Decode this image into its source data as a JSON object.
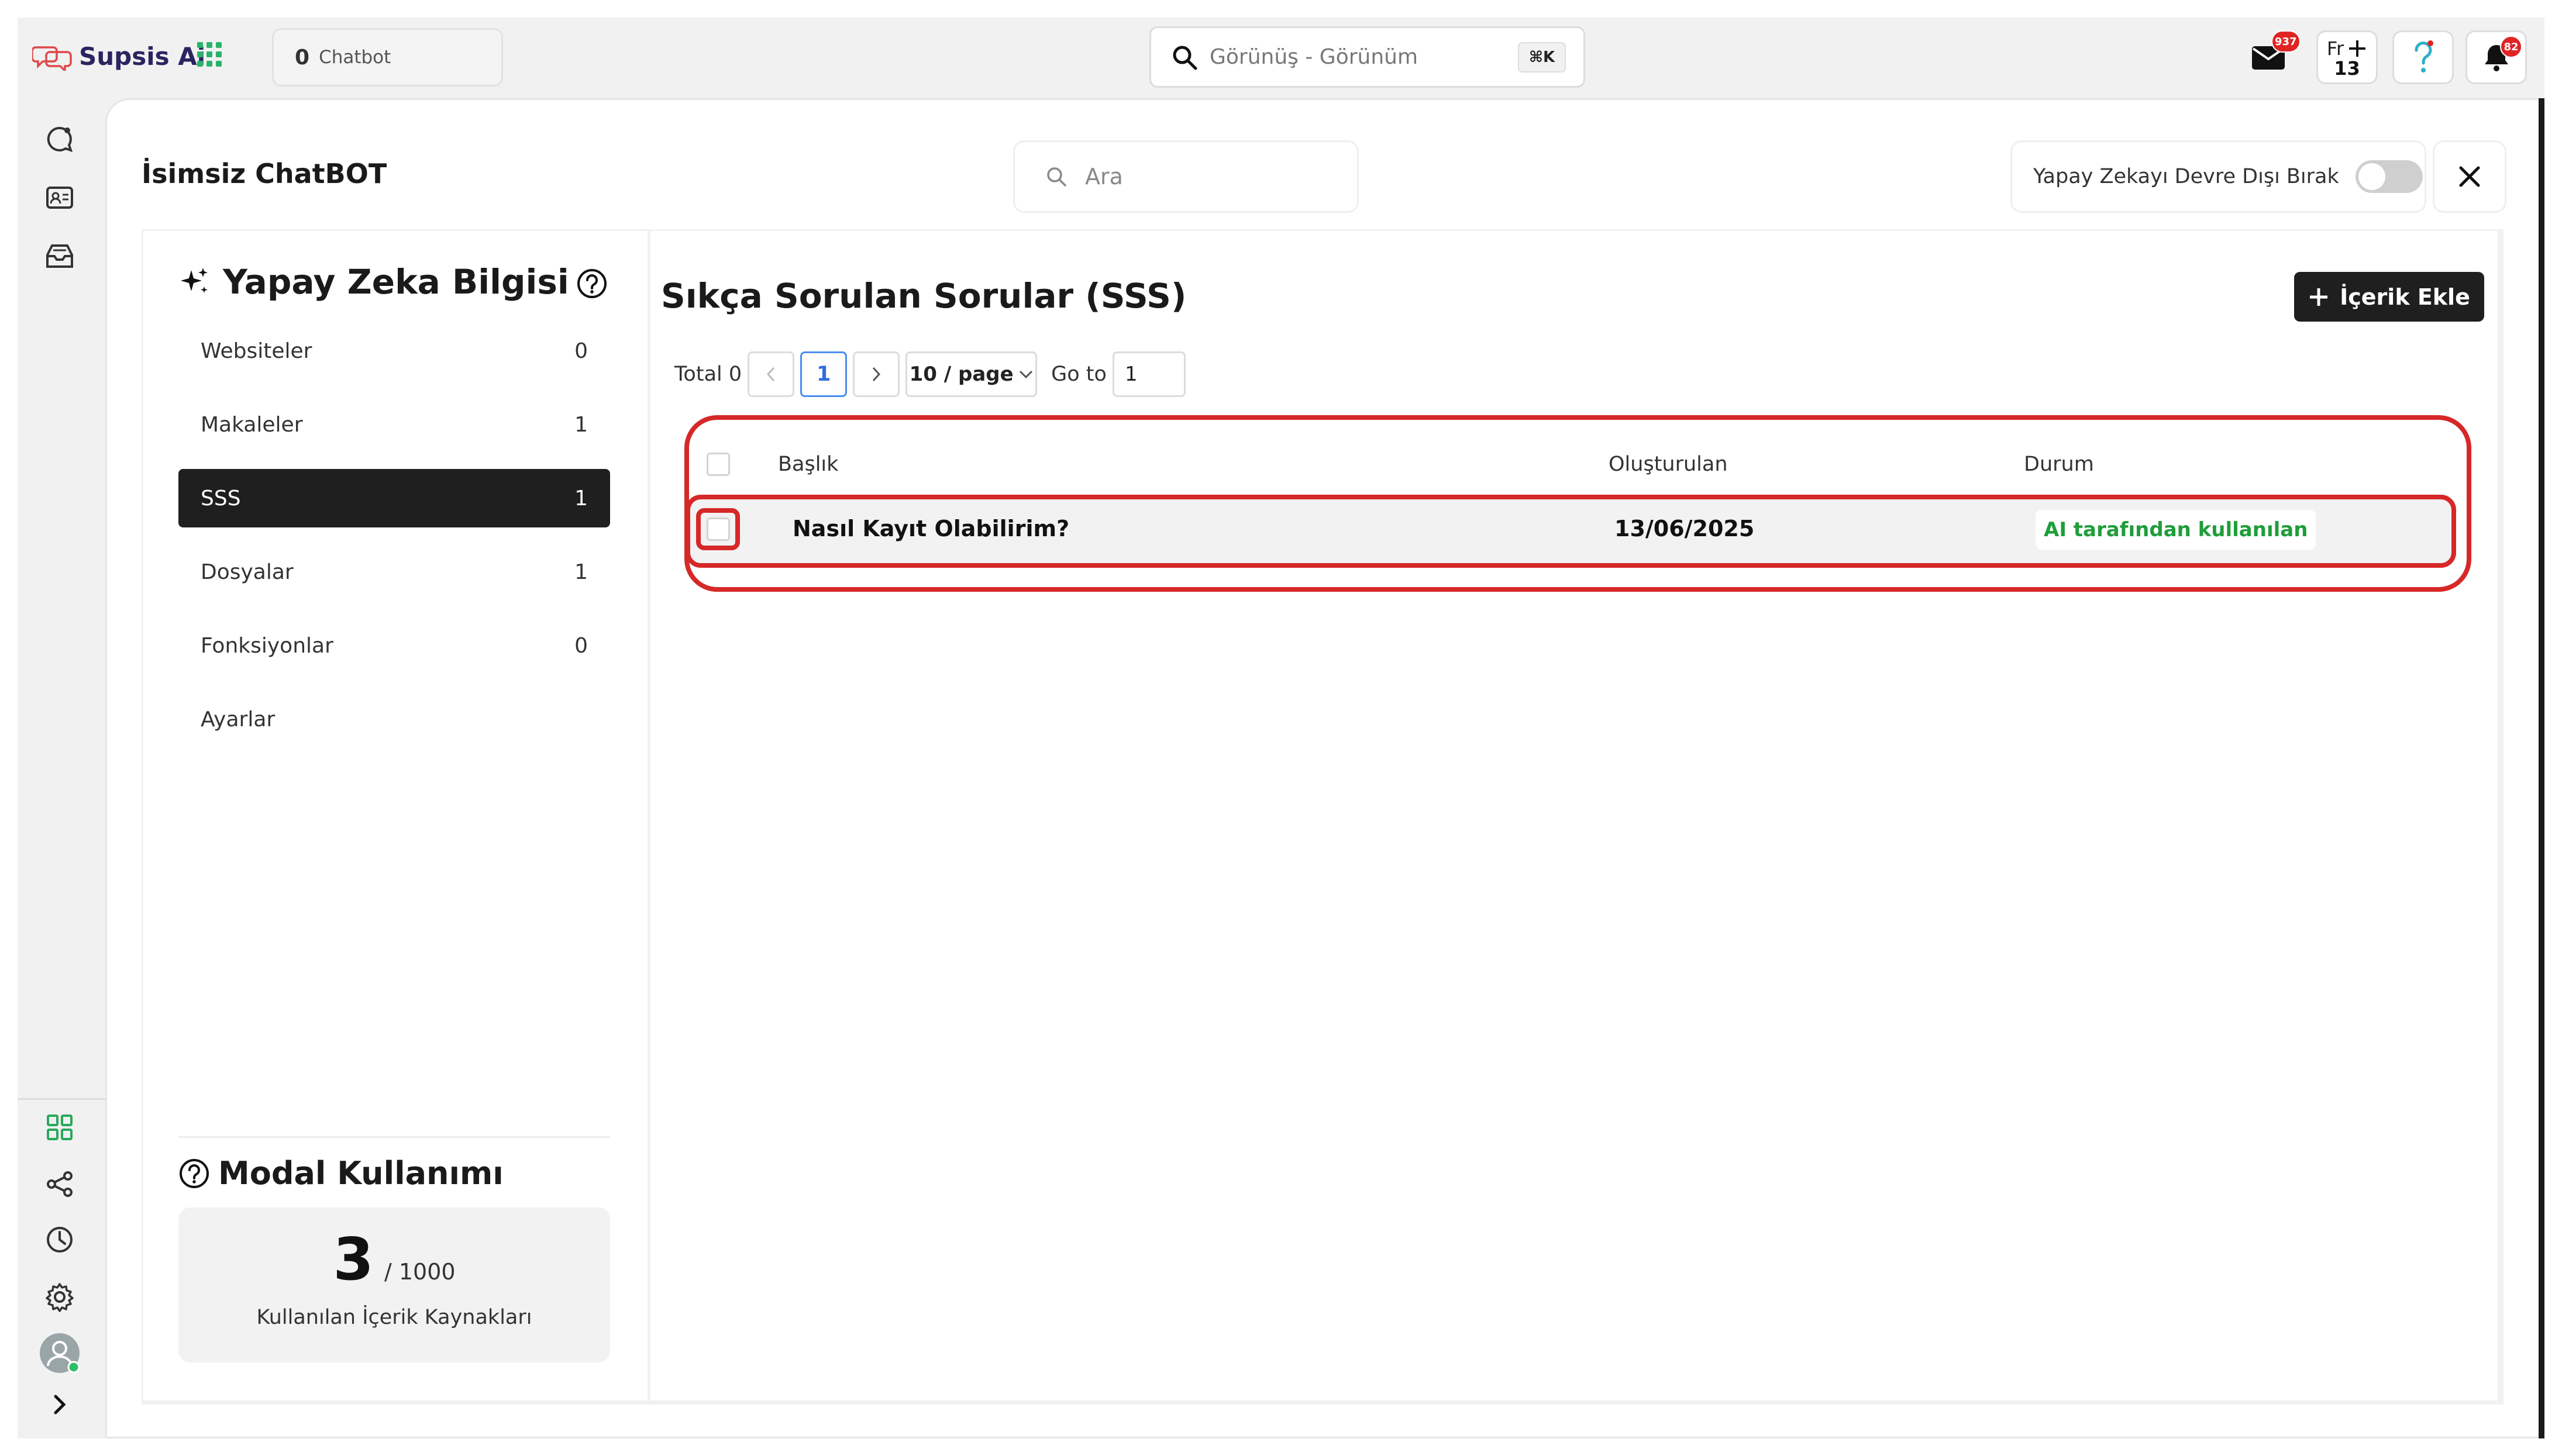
{
  "topbar": {
    "logo_text": "Supsis Ai",
    "chatbot_count": "0",
    "chatbot_label": "Chatbot",
    "search_placeholder": "Görünüş - Görünüm",
    "search_shortcut": "⌘K",
    "mail_badge": "937",
    "fr_label": "Fr",
    "fr_count": "13",
    "bell_badge": "82"
  },
  "panel": {
    "title": "İsimsiz ChatBOT",
    "search_placeholder": "Ara",
    "ai_toggle_label": "Yapay Zekayı Devre Dışı Bırak",
    "ai_toggle_on": false
  },
  "knowledge": {
    "title": "Yapay Zeka Bilgisi",
    "items": [
      {
        "label": "Websiteler",
        "count": "0"
      },
      {
        "label": "Makaleler",
        "count": "1"
      },
      {
        "label": "SSS",
        "count": "1"
      },
      {
        "label": "Dosyalar",
        "count": "1"
      },
      {
        "label": "Fonksiyonlar",
        "count": "0"
      },
      {
        "label": "Ayarlar",
        "count": ""
      }
    ],
    "active_index": 2
  },
  "usage": {
    "title": "Modal Kullanımı",
    "used": "3",
    "limit": "/ 1000",
    "caption": "Kullanılan İçerik Kaynakları"
  },
  "faq": {
    "title": "Sıkça Sorulan Sorular (SSS)",
    "add_button": "İçerik Ekle",
    "pagination": {
      "total_label": "Total 0",
      "current_page": "1",
      "page_size": "10 / page",
      "goto_label": "Go to",
      "goto_value": "1"
    },
    "columns": [
      "Başlık",
      "Oluşturulan",
      "Durum"
    ],
    "rows": [
      {
        "title": "Nasıl Kayıt Olabilirim?",
        "created": "13/06/2025",
        "status": "AI tarafından kullanılan"
      }
    ]
  },
  "colors": {
    "accent_dark": "#1f1f1f",
    "highlight_red": "#d62828",
    "status_green": "#1f9d3a",
    "badge_red": "#e02424",
    "page_blue": "#2f6fe0"
  }
}
